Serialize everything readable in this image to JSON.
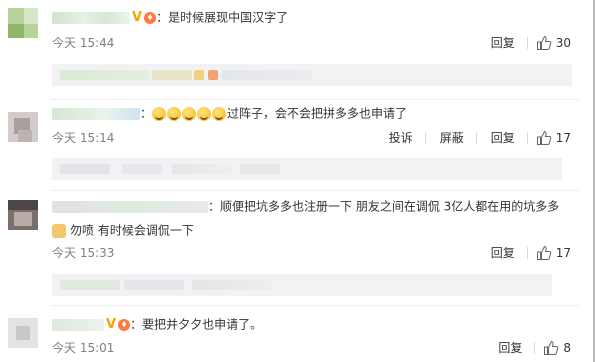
{
  "comments": [
    {
      "text": "：是时候展现中国汉字了",
      "time": "今天 15:44",
      "reply": "回复",
      "likes": "30"
    },
    {
      "text": "过阵子，会不会把拼多多也申请了",
      "time": "今天 15:14",
      "report": "投诉",
      "block": "屏蔽",
      "reply": "回复",
      "likes": "17"
    },
    {
      "text1": "：顺便把坑多多也注册一下  朋友之间在调侃  3亿人都在用的坑多多",
      "text2": "勿喷  有时候会调侃一下",
      "time": "今天 15:33",
      "reply": "回复",
      "likes": "17"
    },
    {
      "text": "：要把并夕夕也申请了。",
      "time": "今天 15:01",
      "reply": "回复",
      "likes": "8"
    }
  ],
  "colors": {
    "badge_v": "#f5a400",
    "level_badge": "#ff7a3d",
    "reply_bg": "#f2f2f5"
  },
  "icons": [
    "thumb-up-icon",
    "verified-v-icon",
    "level-badge-icon",
    "smile-emoji-icon",
    "doge-emoji-icon"
  ]
}
